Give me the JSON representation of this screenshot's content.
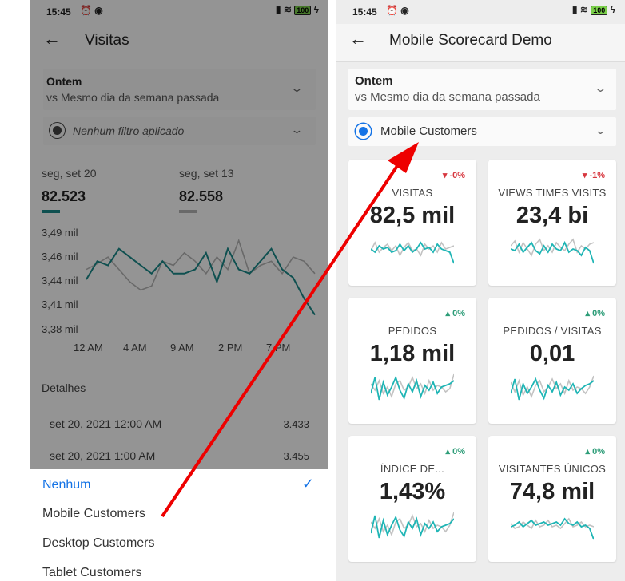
{
  "left": {
    "status": {
      "time": "15:45",
      "battery": "100"
    },
    "title": "Visitas",
    "date_range": {
      "label": "Ontem",
      "compare": "vs Mesmo dia da semana passada"
    },
    "filter": {
      "label": "Nenhum filtro aplicado"
    },
    "summary": {
      "current": {
        "date": "seg, set 20",
        "value": "82.523"
      },
      "previous": {
        "date": "seg, set 13",
        "value": "82.558"
      }
    },
    "chart_data": {
      "type": "line",
      "ylabels": [
        "3,49 mil",
        "3,46 mil",
        "3,44 mil",
        "3,41 mil",
        "3,38 mil"
      ],
      "xlabels": [
        "12 AM",
        "4 AM",
        "9 AM",
        "2 PM",
        "7 PM"
      ],
      "ylim": [
        3.38,
        3.49
      ],
      "series": [
        {
          "color": "#1a8a8a",
          "values": [
            3.433,
            3.455,
            3.45,
            3.47,
            3.46,
            3.45,
            3.44,
            3.455,
            3.44,
            3.44,
            3.445,
            3.465,
            3.43,
            3.47,
            3.445,
            3.44,
            3.455,
            3.47,
            3.445,
            3.435,
            3.41,
            3.39
          ]
        },
        {
          "color": "#b5b5b5",
          "values": [
            3.445,
            3.452,
            3.46,
            3.445,
            3.43,
            3.42,
            3.425,
            3.455,
            3.45,
            3.465,
            3.455,
            3.44,
            3.46,
            3.445,
            3.48,
            3.44,
            3.45,
            3.455,
            3.44,
            3.46,
            3.455,
            3.44
          ]
        }
      ]
    },
    "details": {
      "title": "Detalhes",
      "rows": [
        {
          "date": "set 20, 2021 12:00 AM",
          "value": "3.433"
        },
        {
          "date": "set 20, 2021 1:00 AM",
          "value": "3.455"
        }
      ]
    },
    "sheet": {
      "items": [
        "Nenhum",
        "Mobile Customers",
        "Desktop Customers",
        "Tablet Customers"
      ],
      "selected": "Nenhum"
    }
  },
  "right": {
    "status": {
      "time": "15:45",
      "battery": "100"
    },
    "title": "Mobile Scorecard Demo",
    "date_range": {
      "label": "Ontem",
      "compare": "vs Mesmo dia da semana passada"
    },
    "segment": {
      "label": "Mobile Customers"
    },
    "tiles": [
      {
        "label": "VISITAS",
        "value": "82,5 mil",
        "delta": "-0%",
        "trend": "down"
      },
      {
        "label": "VIEWS TIMES VISITS",
        "value": "23,4 bi",
        "delta": "-1%",
        "trend": "down"
      },
      {
        "label": "PEDIDOS",
        "value": "1,18 mil",
        "delta": "0%",
        "trend": "up"
      },
      {
        "label": "PEDIDOS / VISITAS",
        "value": "0,01",
        "delta": "0%",
        "trend": "up"
      },
      {
        "label": "ÍNDICE DE...",
        "value": "1,43%",
        "delta": "0%",
        "trend": "up"
      },
      {
        "label": "VISITANTES ÚNICOS",
        "value": "74,8 mil",
        "delta": "0%",
        "trend": "up"
      }
    ]
  },
  "colors": {
    "teal": "#1a8a8a",
    "gray_line": "#b5b5b5",
    "accent_blue": "#1473e6",
    "arrow_red": "#ee0000"
  },
  "icons": [
    "back-arrow-icon",
    "chevron-down-icon",
    "segment-icon",
    "check-icon",
    "wifi-icon",
    "signal-icon",
    "battery-icon",
    "alarm-icon"
  ]
}
